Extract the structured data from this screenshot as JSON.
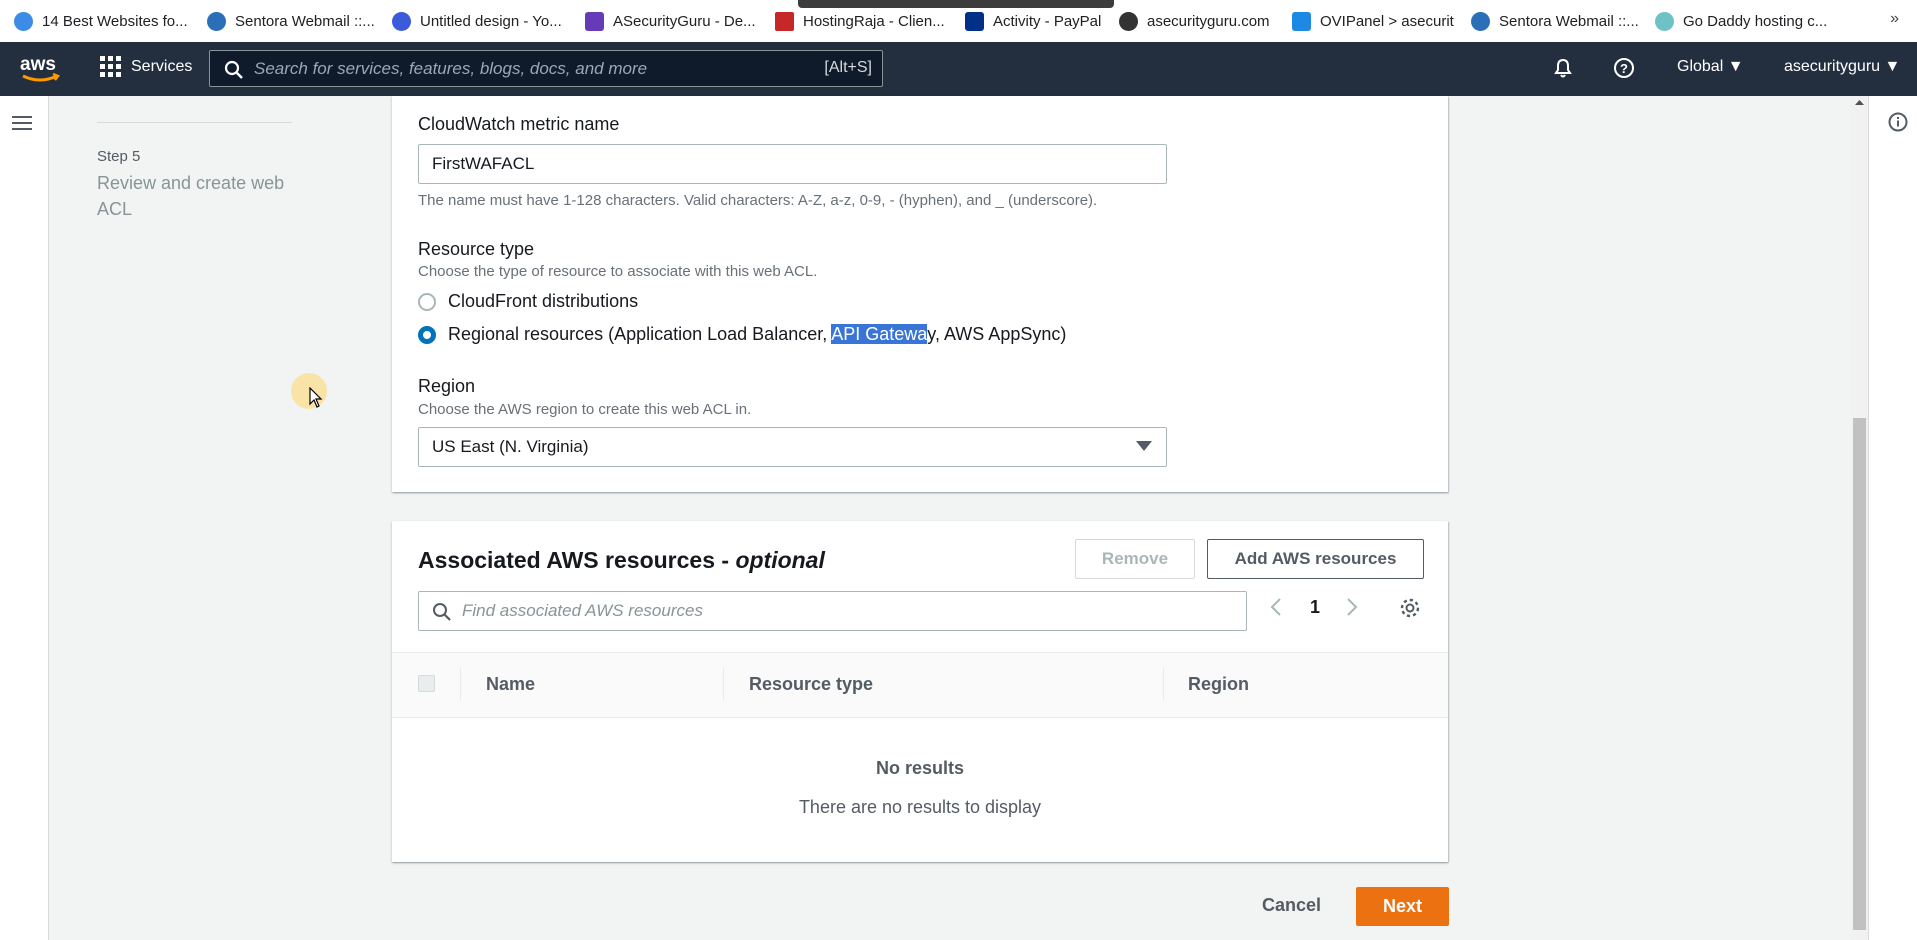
{
  "bookmarks": [
    {
      "label": "14 Best Websites fo...",
      "icon": "m-circle-icon",
      "color": "#3c8ce7"
    },
    {
      "label": "Sentora Webmail ::...",
      "icon": "webmail-icon",
      "color": "#2a6fb7"
    },
    {
      "label": "Untitled design - Yo...",
      "icon": "canva-icon",
      "color": "#3b5bdb"
    },
    {
      "label": "ASecurityGuru - De...",
      "icon": "doc-icon",
      "color": "#673ab7"
    },
    {
      "label": "HostingRaja - Clien...",
      "icon": "hr-icon",
      "color": "#c62828"
    },
    {
      "label": "Activity - PayPal",
      "icon": "paypal-icon",
      "color": "#003087"
    },
    {
      "label": "asecurityguru.com",
      "icon": "globe-icon",
      "color": "#333333"
    },
    {
      "label": "OVIPanel > asecurit",
      "icon": "ovi-icon",
      "color": "#1e88e5"
    },
    {
      "label": "Sentora Webmail ::...",
      "icon": "webmail-icon",
      "color": "#2a6fb7"
    },
    {
      "label": "Go Daddy hosting c...",
      "icon": "godaddy-icon",
      "color": "#6ec1c4"
    }
  ],
  "header": {
    "logo": "aws",
    "services": "Services",
    "search_placeholder": "Search for services, features, blogs, docs, and more",
    "search_shortcut": "[Alt+S]",
    "region": "Global",
    "account": "asecurityguru"
  },
  "sidebar": {
    "step_label": "Step 5",
    "step_title": "Review and create web ACL"
  },
  "form": {
    "metric_label": "CloudWatch metric name",
    "metric_value": "FirstWAFACL",
    "metric_hint": "The name must have 1-128 characters. Valid characters: A-Z, a-z, 0-9, - (hyphen), and _ (underscore).",
    "resource_label": "Resource type",
    "resource_desc": "Choose the type of resource to associate with this web ACL.",
    "option_cloudfront": "CloudFront distributions",
    "option_regional_a": "Regional resources (Application Load Balancer, ",
    "option_regional_hl": "API Gatewa",
    "option_regional_b": "y, AWS AppSync)",
    "region_label": "Region",
    "region_desc": "Choose the AWS region to create this web ACL in.",
    "region_value": "US East (N. Virginia)"
  },
  "associated": {
    "title": "Associated AWS resources - ",
    "title_em": "optional",
    "remove": "Remove",
    "add": "Add AWS resources",
    "search_placeholder": "Find associated AWS resources",
    "page": "1",
    "columns": [
      "Name",
      "Resource type",
      "Region"
    ],
    "empty_title": "No results",
    "empty_desc": "There are no results to display"
  },
  "footer": {
    "cancel": "Cancel",
    "next": "Next"
  },
  "colors": {
    "header_bg": "#232f3e",
    "primary": "#ec7211",
    "radio_selected": "#0073bb",
    "selection_highlight": "#3875d7"
  }
}
